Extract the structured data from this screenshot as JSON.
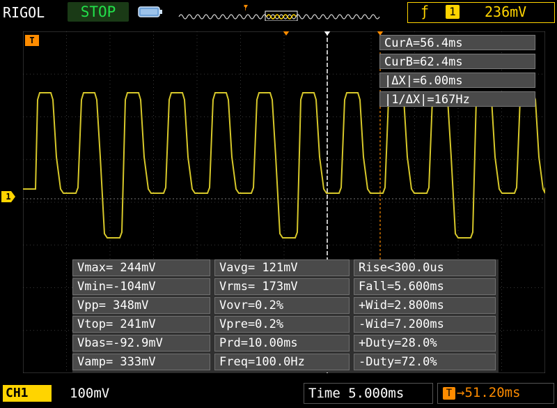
{
  "header": {
    "brand": "RIGOL",
    "run_state": "STOP",
    "trigger_source": "1",
    "trigger_level": "236mV"
  },
  "cursors": {
    "cur_a": "CurA=56.4ms",
    "cur_b": "CurB=62.4ms",
    "delta_x": "|ΔX|=6.00ms",
    "inv_delta_x": "|1/ΔX|=167Hz"
  },
  "measurements": [
    [
      "Vmax= 244mV",
      "Vavg= 121mV",
      "Rise<300.0us"
    ],
    [
      "Vmin=-104mV",
      "Vrms= 173mV",
      "Fall=5.600ms"
    ],
    [
      "Vpp= 348mV",
      "Vovr=0.2%",
      "+Wid=2.800ms"
    ],
    [
      "Vtop= 241mV",
      "Vpre=0.2%",
      "-Wid=7.200ms"
    ],
    [
      "Vbas=-92.9mV",
      "Prd=10.00ms",
      "+Duty=28.0%"
    ],
    [
      "Vamp= 333mV",
      "Freq=100.0Hz",
      "-Duty=72.0%"
    ]
  ],
  "footer": {
    "channel_label": "CH1",
    "channel_scale": "100mV",
    "timebase": "Time 5.000ms",
    "trigger_delay": "51.20ms"
  },
  "markers": {
    "channel": "1",
    "trigger": "T"
  },
  "colors": {
    "trace": "#d7c82a",
    "channel": "#ffd400",
    "trigger": "#ff8c00",
    "run_state": "#22e04a"
  }
}
